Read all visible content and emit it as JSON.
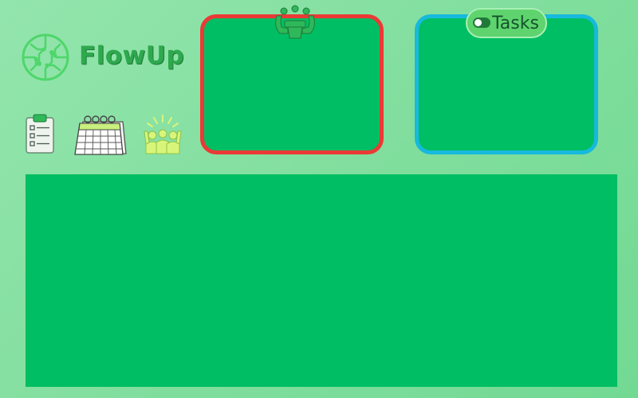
{
  "app": {
    "name": "FlowUp",
    "logo_icon": "circuit-brain-icon"
  },
  "toolbar": {
    "items": [
      {
        "icon": "checklist-icon"
      },
      {
        "icon": "calendar-icon"
      },
      {
        "icon": "team-celebration-icon"
      }
    ]
  },
  "panels": {
    "team": {
      "icon": "team-meeting-icon",
      "border_color": "#ea3a35"
    },
    "tasks": {
      "label": "Tasks",
      "toggle_icon": "toggle-icon",
      "border_color": "#17b9dd"
    }
  },
  "colors": {
    "background": "#87e1a3",
    "panel_fill": "#00be63",
    "brand_text": "#2fa84e"
  }
}
